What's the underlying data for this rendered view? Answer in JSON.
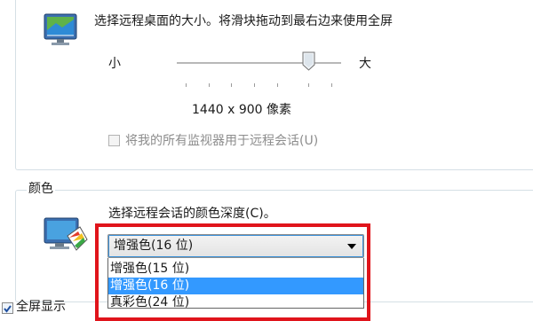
{
  "display": {
    "instruction": "选择远程桌面的大小。将滑块拖动到最右边来使用全屏",
    "slider": {
      "min_label": "小",
      "max_label": "大",
      "level": 0.79
    },
    "resolution": "1440 x 900 像素",
    "use_all_monitors": {
      "label": "将我的所有监视器用于远程会话(U)",
      "checked": false
    }
  },
  "colors": {
    "section_label": "颜色",
    "instruction": "选择远程会话的颜色深度(C)。",
    "selected": "增强色(16 位)",
    "options": [
      "增强色(15 位)",
      "增强色(16 位)",
      "真彩色(24 位)"
    ],
    "highlighted_option": "增强色(16 位)"
  },
  "bottom": {
    "fullscreen_checkbox_label": "全屏显示"
  },
  "accent": {
    "highlight_border": "#e0141b",
    "selection": "#3399ff"
  }
}
